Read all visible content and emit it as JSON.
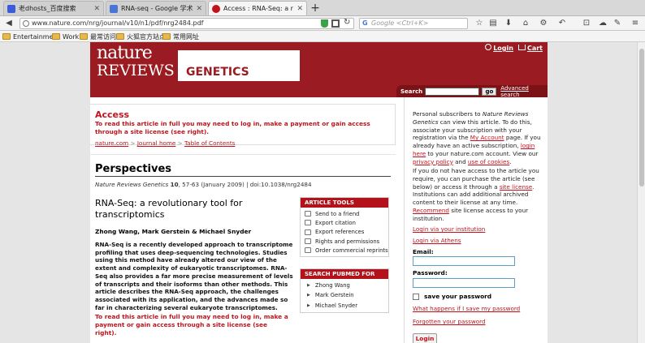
{
  "browser": {
    "tabs": [
      {
        "label": "老dhosts_百度搜索",
        "favicon_color": "#3b5bdb"
      },
      {
        "label": "RNA-seq - Google 学术...",
        "favicon_color": "#4a76d6"
      },
      {
        "label": "Access : RNA-Seq: a rev...",
        "favicon_color": "#c3121b"
      }
    ],
    "new_tab": "+",
    "url": "www.nature.com/nrg/journal/v10/n1/pdf/nrg2484.pdf",
    "search_placeholder": "Google <Ctrl+K>",
    "search_engine_glyph": "G",
    "bookmarks": [
      "Entertainment",
      "Work",
      "最常访问",
      "火狐官方站点",
      "常用网址"
    ]
  },
  "header": {
    "logo_line1": "nature",
    "logo_line2": "REVIEWS",
    "logo_genetics": "GENETICS",
    "login": "Login",
    "cart": "Cart",
    "search_label": "Search",
    "go_button": "go",
    "advanced_search": "Advanced search"
  },
  "access": {
    "title": "Access",
    "message": "To read this article in full you may need to log in, make a payment or gain access through a site license (see right).",
    "breadcrumb": [
      "nature.com",
      "Journal home",
      "Table of Contents"
    ],
    "breadcrumb_sep": ">"
  },
  "article": {
    "section": "Perspectives",
    "citation_journal": "Nature Reviews Genetics",
    "citation_volume": "10",
    "citation_rest": ", 57-63 (January 2009) | doi:10.1038/nrg2484",
    "title": "RNA-Seq: a revolutionary tool for transcriptomics",
    "authors": "Zhong Wang, Mark Gerstein & Michael Snyder",
    "abstract": "RNA-Seq is a recently developed approach to transcriptome profiling that uses deep-sequencing technologies. Studies using this method have already altered our view of the extent and complexity of eukaryotic transcriptomes. RNA-Seq also provides a far more precise measurement of levels of transcripts and their isoforms than other methods. This article describes the RNA-Seq approach, the challenges associated with its application, and the advances made so far in characterizing several eukaryote transcriptomes.",
    "access_message": "To read this article in full you may need to log in, make a payment or gain access through a site license (see right)."
  },
  "tools": {
    "heading": "ARTICLE TOOLS",
    "items": [
      "Send to a friend",
      "Export citation",
      "Export references",
      "Rights and permissions",
      "Order commercial reprints"
    ]
  },
  "pubmed": {
    "heading": "SEARCH PUBMED FOR",
    "items": [
      "Zhong Wang",
      "Mark Gerstein",
      "Michael Snyder"
    ]
  },
  "sidebar": {
    "p1_a": "Personal subscribers to ",
    "p1_journal": "Nature Reviews Genetics",
    "p1_b": " can view this article. To do this, associate your subscription with your registration via the ",
    "p1_link1": "My Account",
    "p1_c": " page. If you already have an active subscription, ",
    "p1_link2": "login here",
    "p1_d": " to your nature.com account. View our ",
    "p1_link3": "privacy policy",
    "p1_e": " and ",
    "p1_link4": "use of cookies",
    "p1_f": ".",
    "p2_a": "If you do not have access to the article you require, you can purchase the article (see below) or access it through a ",
    "p2_link1": "site license",
    "p2_b": ". Institutions can add additional archived content to their license at any time. ",
    "p2_link2": "Recommend",
    "p2_c": " site license access to your institution.",
    "login_institution": "Login via your institution",
    "login_athens": "Login via Athens",
    "email_label": "Email:",
    "password_label": "Password:",
    "save_password": "save your password",
    "what_happens": "What happens if I save my password",
    "forgotten": "Forgotten your password",
    "login_button": "Login"
  }
}
